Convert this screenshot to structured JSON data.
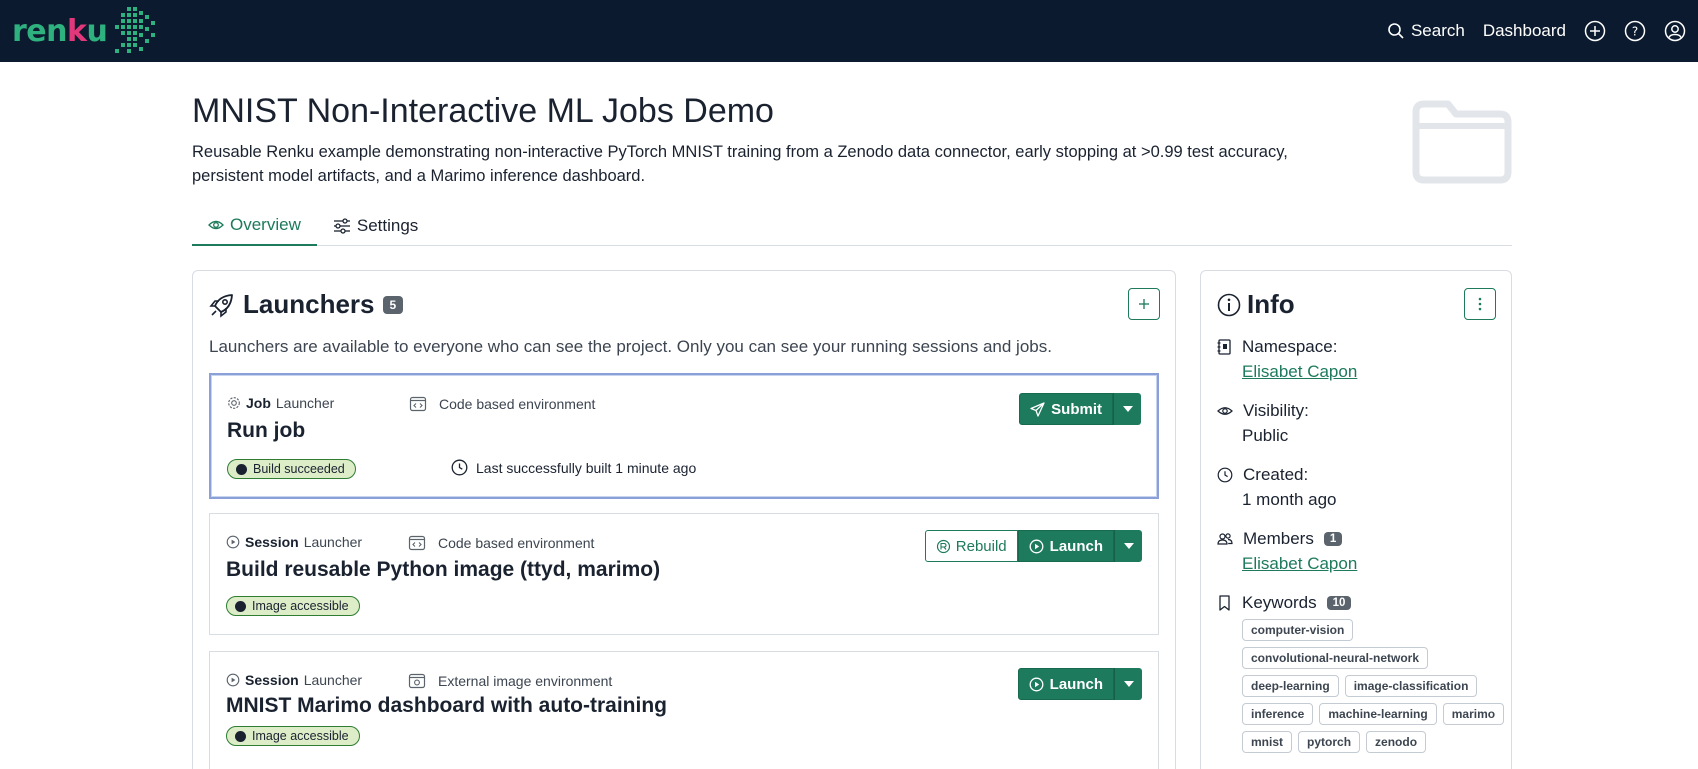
{
  "nav": {
    "logo_text_start": "ren",
    "logo_text_k": "k",
    "logo_text_end": "u",
    "search_label": "Search",
    "dashboard_label": "Dashboard"
  },
  "project": {
    "title": "MNIST Non-Interactive ML Jobs Demo",
    "description": "Reusable Renku example demonstrating non-interactive PyTorch MNIST training from a Zenodo data connector, early stopping at >0.99 test accuracy, persistent model artifacts, and a Marimo inference dashboard."
  },
  "tabs": [
    {
      "label": "Overview",
      "active": true
    },
    {
      "label": "Settings",
      "active": false
    }
  ],
  "launchers": {
    "title": "Launchers",
    "count": "5",
    "note": "Launchers are available to everyone who can see the project. Only you can see your running sessions and jobs.",
    "items": [
      {
        "type_bold": "Job",
        "type_rest": "Launcher",
        "env": "Code based environment",
        "name": "Run job",
        "status": "Build succeeded",
        "built": "Last successfully built 1 minute ago",
        "action": "Submit"
      },
      {
        "type_bold": "Session",
        "type_rest": "Launcher",
        "env": "Code based environment",
        "name": "Build reusable Python image (ttyd, marimo)",
        "status": "Image accessible",
        "rebuild": "Rebuild",
        "action": "Launch"
      },
      {
        "type_bold": "Session",
        "type_rest": "Launcher",
        "env": "External image environment",
        "name": "MNIST Marimo dashboard with auto-training",
        "status": "Image accessible",
        "action": "Launch"
      }
    ]
  },
  "info": {
    "title": "Info",
    "namespace_label": "Namespace:",
    "namespace_value": "Elisabet Capon",
    "visibility_label": "Visibility:",
    "visibility_value": "Public",
    "created_label": "Created:",
    "created_value": "1 month ago",
    "members_label": "Members",
    "members_count": "1",
    "members_value": "Elisabet Capon",
    "keywords_label": "Keywords",
    "keywords_count": "10",
    "keywords": [
      "computer-vision",
      "convolutional-neural-network",
      "deep-learning",
      "image-classification",
      "inference",
      "machine-learning",
      "marimo",
      "mnist",
      "pytorch",
      "zenodo"
    ]
  },
  "colors": {
    "nav_bg": "#0b1a2e",
    "brand_green": "#1d7a5c",
    "logo_green": "#2fb07f",
    "logo_pink": "#e0387a",
    "status_bg": "#dcedc8"
  }
}
